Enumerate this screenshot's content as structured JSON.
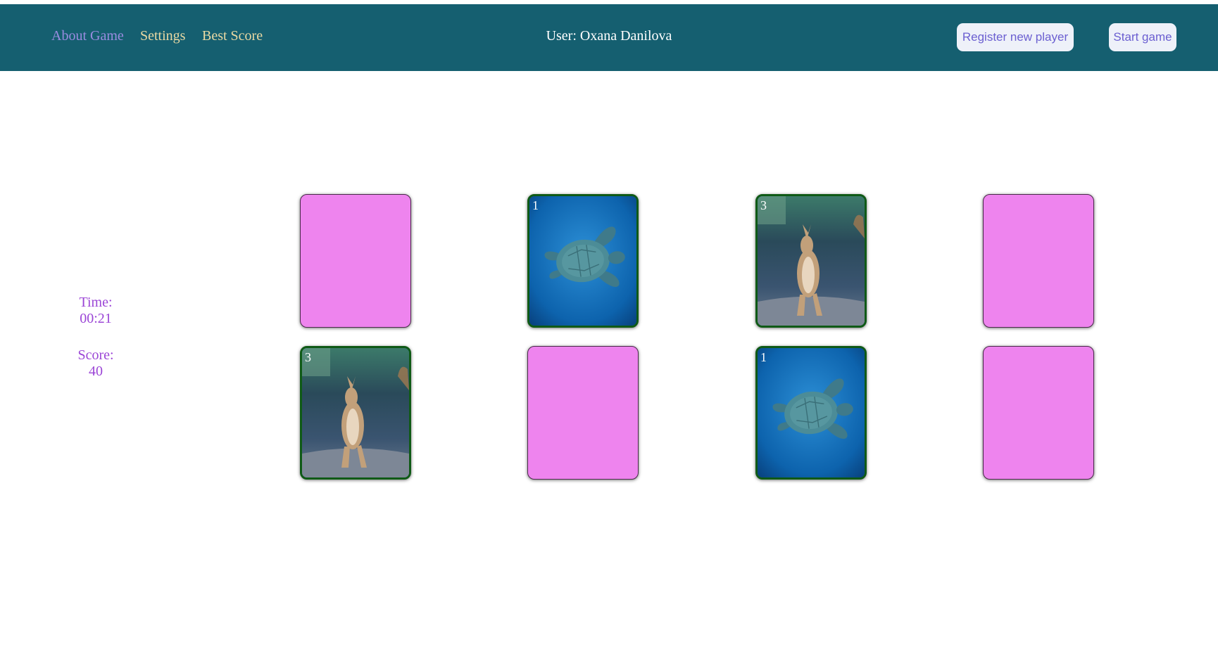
{
  "nav": {
    "about": "About Game",
    "settings": "Settings",
    "best_score": "Best Score"
  },
  "user": "User: Oxana Danilova",
  "buttons": {
    "register": "Register new player",
    "start": "Start game"
  },
  "stats": {
    "time_label": "Time:",
    "time_value": "00:21",
    "score_label": "Score:",
    "score_value": "40"
  },
  "cards": [
    {
      "state": "hidden"
    },
    {
      "state": "revealed",
      "number": "1",
      "image": "turtle"
    },
    {
      "state": "revealed",
      "number": "3",
      "image": "kangaroo"
    },
    {
      "state": "hidden"
    },
    {
      "state": "revealed",
      "number": "3",
      "image": "kangaroo"
    },
    {
      "state": "hidden"
    },
    {
      "state": "revealed",
      "number": "1",
      "image": "turtle"
    },
    {
      "state": "hidden"
    }
  ],
  "colors": {
    "header_bg": "#155f70",
    "card_back": "#ee84ee",
    "card_face_border": "#0f5a16",
    "stats_text": "#9b45d6",
    "nav_text": "#e9d9a3",
    "nav_active": "#9a8ce0"
  }
}
